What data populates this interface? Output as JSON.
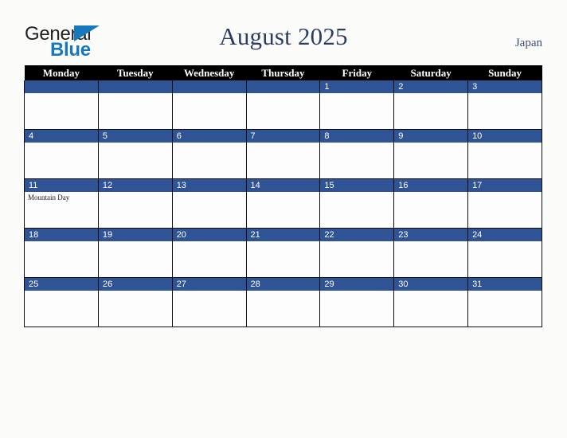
{
  "brand": {
    "name_part1": "General",
    "name_part2": "Blue",
    "triangle_icon": "triangle-icon",
    "colors": {
      "dark": "#231f20",
      "blue": "#1878be"
    }
  },
  "header": {
    "title": "August 2025",
    "country": "Japan",
    "title_color": "#2c3c63"
  },
  "calendar": {
    "weekdays": [
      "Monday",
      "Tuesday",
      "Wednesday",
      "Thursday",
      "Friday",
      "Saturday",
      "Sunday"
    ],
    "header_bg": "#000000",
    "daynum_bg": "#2f5496",
    "cell_bg": "#fdfdfd",
    "weeks": [
      [
        {
          "day": "",
          "events": []
        },
        {
          "day": "",
          "events": []
        },
        {
          "day": "",
          "events": []
        },
        {
          "day": "",
          "events": []
        },
        {
          "day": "1",
          "events": []
        },
        {
          "day": "2",
          "events": []
        },
        {
          "day": "3",
          "events": []
        }
      ],
      [
        {
          "day": "4",
          "events": []
        },
        {
          "day": "5",
          "events": []
        },
        {
          "day": "6",
          "events": []
        },
        {
          "day": "7",
          "events": []
        },
        {
          "day": "8",
          "events": []
        },
        {
          "day": "9",
          "events": []
        },
        {
          "day": "10",
          "events": []
        }
      ],
      [
        {
          "day": "11",
          "events": [
            "Mountain Day"
          ]
        },
        {
          "day": "12",
          "events": []
        },
        {
          "day": "13",
          "events": []
        },
        {
          "day": "14",
          "events": []
        },
        {
          "day": "15",
          "events": []
        },
        {
          "day": "16",
          "events": []
        },
        {
          "day": "17",
          "events": []
        }
      ],
      [
        {
          "day": "18",
          "events": []
        },
        {
          "day": "19",
          "events": []
        },
        {
          "day": "20",
          "events": []
        },
        {
          "day": "21",
          "events": []
        },
        {
          "day": "22",
          "events": []
        },
        {
          "day": "23",
          "events": []
        },
        {
          "day": "24",
          "events": []
        }
      ],
      [
        {
          "day": "25",
          "events": []
        },
        {
          "day": "26",
          "events": []
        },
        {
          "day": "27",
          "events": []
        },
        {
          "day": "28",
          "events": []
        },
        {
          "day": "29",
          "events": []
        },
        {
          "day": "30",
          "events": []
        },
        {
          "day": "31",
          "events": []
        }
      ]
    ]
  }
}
